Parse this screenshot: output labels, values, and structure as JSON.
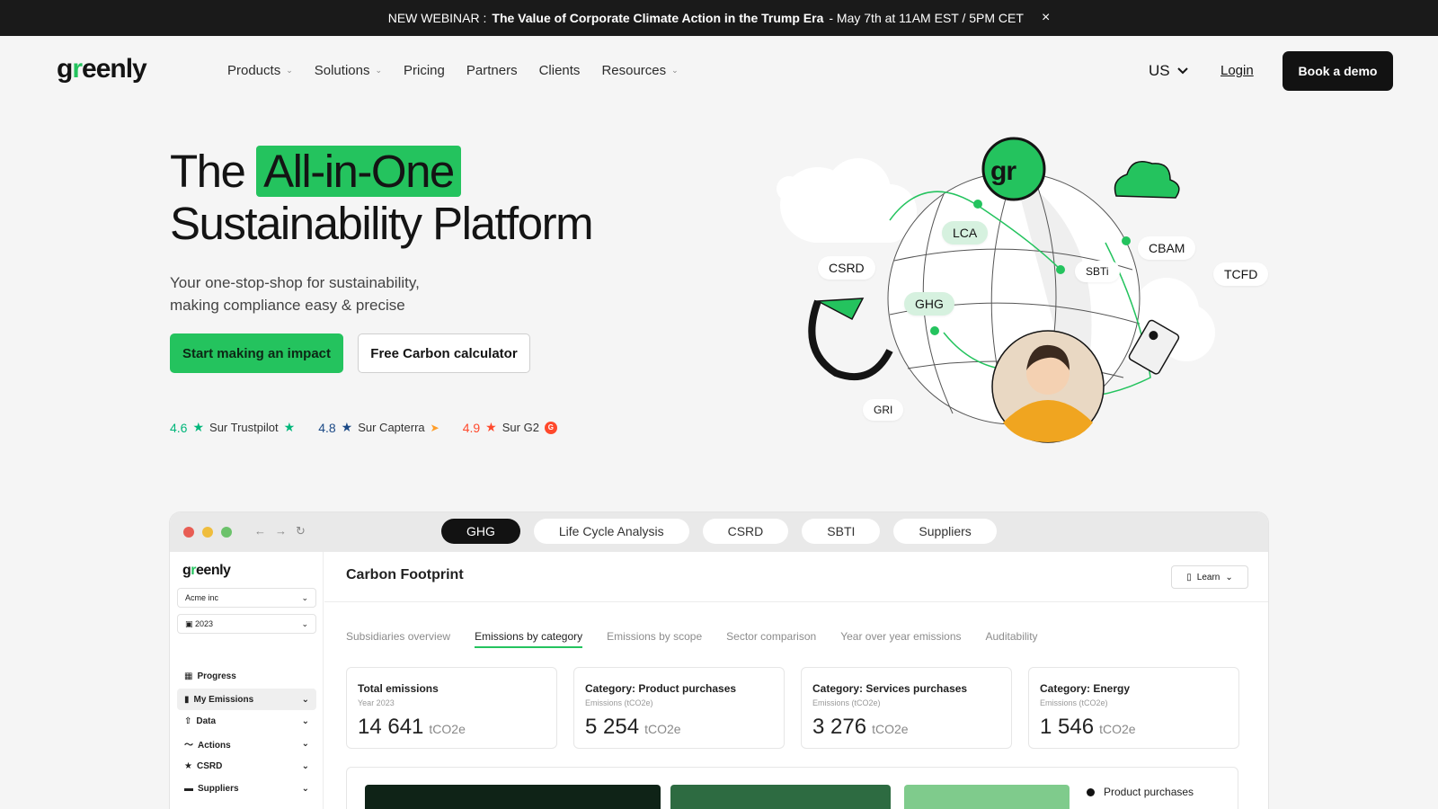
{
  "announcement": {
    "prefix": "NEW WEBINAR :",
    "title": "The Value of Corporate Climate Action in the Trump Era",
    "suffix": "- May 7th at 11AM EST / 5PM CET",
    "close": "×"
  },
  "nav": {
    "logo_pre": "g",
    "logo_r": "r",
    "logo_post": "eenly",
    "menu": [
      {
        "label": "Products",
        "dropdown": true
      },
      {
        "label": "Solutions",
        "dropdown": true
      },
      {
        "label": "Pricing",
        "dropdown": false
      },
      {
        "label": "Partners",
        "dropdown": false
      },
      {
        "label": "Clients",
        "dropdown": false
      },
      {
        "label": "Resources",
        "dropdown": true
      }
    ],
    "language": "US",
    "login": "Login",
    "cta": "Book a demo"
  },
  "hero": {
    "title_pre": "The",
    "title_highlight": "All-in-One",
    "title_line2": "Sustainability Platform",
    "subtitle": "Your one-stop-shop for sustainability, making compliance easy & precise",
    "primary_cta": "Start making an impact",
    "secondary_cta": "Free Carbon calculator",
    "ratings": [
      {
        "score": "4.6",
        "source": "Sur Trustpilot",
        "color": "#00b67a"
      },
      {
        "score": "4.8",
        "source": "Sur Capterra",
        "color": "#1c4a86"
      },
      {
        "score": "4.9",
        "source": "Sur G2",
        "color": "#ff492c"
      }
    ]
  },
  "illustration": {
    "badge": "gr",
    "tags": [
      "LCA",
      "SBTi",
      "CBAM",
      "TCFD",
      "CSRD",
      "GHG",
      "GRI"
    ]
  },
  "app": {
    "tabs": [
      {
        "label": "GHG",
        "active": true
      },
      {
        "label": "Life Cycle Analysis",
        "active": false
      },
      {
        "label": "CSRD",
        "active": false
      },
      {
        "label": "SBTI",
        "active": false
      },
      {
        "label": "Suppliers",
        "active": false
      }
    ],
    "sidebar": {
      "logo_pre": "g",
      "logo_r": "r",
      "logo_post": "eenly",
      "company": "Acme inc",
      "year": "2023",
      "items": [
        {
          "label": "Progress",
          "icon": "grid-icon",
          "chevron": false
        },
        {
          "label": "My Emissions",
          "icon": "bar-chart-icon",
          "chevron": true,
          "active": true
        },
        {
          "label": "Data",
          "icon": "upload-icon",
          "chevron": true
        },
        {
          "label": "Actions",
          "icon": "trend-icon",
          "chevron": true
        },
        {
          "label": "CSRD",
          "icon": "star-icon",
          "chevron": true
        },
        {
          "label": "Suppliers",
          "icon": "folder-icon",
          "chevron": true
        }
      ]
    },
    "main": {
      "title": "Carbon Footprint",
      "learn": "Learn",
      "subtabs": [
        {
          "label": "Subsidiaries overview",
          "active": false
        },
        {
          "label": "Emissions by category",
          "active": true
        },
        {
          "label": "Emissions by scope",
          "active": false
        },
        {
          "label": "Sector comparison",
          "active": false
        },
        {
          "label": "Year over year emissions",
          "active": false
        },
        {
          "label": "Auditability",
          "active": false
        }
      ],
      "kpis": [
        {
          "title": "Total emissions",
          "sub": "Year 2023",
          "value": "14 641",
          "unit": "tCO2e"
        },
        {
          "title": "Category: Product purchases",
          "sub": "Emissions (tCO2e)",
          "value": "5 254",
          "unit": "tCO2e"
        },
        {
          "title": "Category: Services purchases",
          "sub": "Emissions (tCO2e)",
          "value": "3 276",
          "unit": "tCO2e"
        },
        {
          "title": "Category: Energy",
          "sub": "Emissions (tCO2e)",
          "value": "1 546",
          "unit": "tCO2e"
        }
      ],
      "legend": "Product purchases",
      "bar_colors": [
        "#0f2317",
        "#2d6b41",
        "#7fcb8c"
      ]
    }
  },
  "colors": {
    "accent": "#24c35e",
    "dark": "#121212"
  }
}
